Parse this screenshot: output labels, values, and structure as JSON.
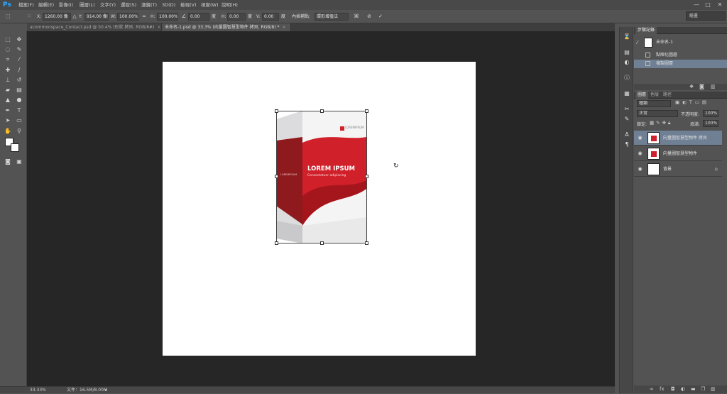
{
  "app": {
    "logo": "Ps"
  },
  "menu": [
    "檔案(F)",
    "編輯(E)",
    "影像(I)",
    "圖層(L)",
    "文字(Y)",
    "選取(S)",
    "濾鏡(T)",
    "3D(D)",
    "檢視(V)",
    "視窗(W)",
    "說明(H)"
  ],
  "window_controls": {
    "minimize": "—",
    "maximize": "□",
    "close": "✕"
  },
  "options": {
    "x_label": "X:",
    "x_value": "1260.00 像",
    "y_label": "Y:",
    "y_value": "914.00 像素",
    "w_label": "W:",
    "w_value": "100.00%",
    "h_label": "H:",
    "h_value": "100.00%",
    "angle_value": "0.00",
    "angle_unit": "度",
    "hskew_label": "H:",
    "hskew_value": "0.00",
    "hskew_unit": "度",
    "vskew_label": "V:",
    "vskew_value": "0.00",
    "vskew_unit": "度",
    "interp_label": "內插補點:",
    "interp_value": "環形增值法"
  },
  "workspace": {
    "value": "繪畫"
  },
  "tabs": [
    {
      "label": "acommonspace_Contact.psd @ 50.4% (形狀 拷貝, RGB/8#)",
      "close": "×"
    },
    {
      "label": "未命名-1.psd @ 33.3% (向量圖智慧型物件 拷貝, RGB/8) *",
      "close": "×"
    }
  ],
  "product": {
    "brand": "LOREM IPSUM",
    "tagline": "Consectetuer adipiscing",
    "small_logo": "LOREMIPSUM",
    "colors": {
      "red": "#d0202a",
      "dark_red": "#8e1a1d",
      "white": "#f4f4f4",
      "grey": "#c9c9cb"
    }
  },
  "status": {
    "zoom": "33.33%",
    "doc": "文件：16.5M/8.00M"
  },
  "history": {
    "tab": "步驟記錄",
    "snapshot": "未命名-1",
    "rows": [
      "點陣化圖層",
      "複製圖層"
    ]
  },
  "layers": {
    "tabs": [
      "圖層",
      "色版",
      "路徑"
    ],
    "filter": "種類",
    "blend": "正常",
    "opacity_label": "不透明度:",
    "opacity_value": "100%",
    "lock_label": "鎖定:",
    "fill_label": "填滿:",
    "fill_value": "100%",
    "items": [
      {
        "name": "向量圖智慧型物件 拷貝"
      },
      {
        "name": "向量圖智慧型物件"
      },
      {
        "name": "背景"
      }
    ]
  }
}
